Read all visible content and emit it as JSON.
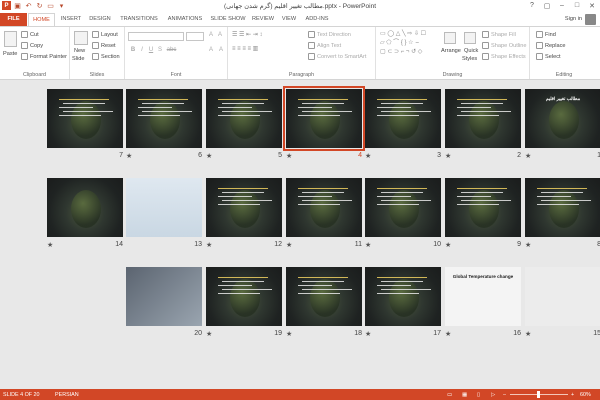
{
  "window": {
    "title": "مطالب تغییر اقلیم (گرم شدن جهانی).pptx - PowerPoint",
    "controls": [
      "?",
      "▢",
      "–",
      "□",
      "✕"
    ]
  },
  "tabs": [
    "FILE",
    "HOME",
    "INSERT",
    "DESIGN",
    "TRANSITIONS",
    "ANIMATIONS",
    "SLIDE SHOW",
    "REVIEW",
    "VIEW",
    "ADD-INS"
  ],
  "active_tab": "HOME",
  "user": {
    "signin": "Sign in"
  },
  "ribbon": {
    "clipboard": {
      "label": "Clipboard",
      "paste": "Paste",
      "cut": "Cut",
      "copy": "Copy",
      "format_painter": "Format Painter"
    },
    "slides": {
      "label": "Slides",
      "new_slide": "New",
      "new_slide2": "Slide",
      "layout": "Layout",
      "reset": "Reset",
      "section": "Section"
    },
    "font": {
      "label": "Font",
      "bold": "B",
      "italic": "I",
      "underline": "U",
      "strike": "S",
      "shadow": "abc",
      "grow": "A",
      "shrink": "A",
      "clear": "A",
      "color": "A"
    },
    "paragraph": {
      "label": "Paragraph",
      "text_direction": "Text Direction",
      "align_text": "Align Text",
      "smartart": "Convert to SmartArt"
    },
    "drawing": {
      "label": "Drawing",
      "arrange": "Arrange",
      "quick_styles": "Quick",
      "quick_styles2": "Styles",
      "shape_fill": "Shape Fill",
      "shape_outline": "Shape Outline",
      "shape_effects": "Shape Effects"
    },
    "editing": {
      "label": "Editing",
      "find": "Find",
      "replace": "Replace",
      "select": "Select"
    }
  },
  "slides": [
    {
      "num": "1",
      "star": "★",
      "title": "مطالب تغییر اقلیم"
    },
    {
      "num": "2",
      "star": "★"
    },
    {
      "num": "3",
      "star": "★"
    },
    {
      "num": "4",
      "star": "★",
      "selected": true
    },
    {
      "num": "5",
      "star": "★"
    },
    {
      "num": "6",
      "star": "★"
    },
    {
      "num": "7",
      "star": ""
    },
    {
      "num": "8",
      "star": "★"
    },
    {
      "num": "9",
      "star": "★"
    },
    {
      "num": "10",
      "star": "★"
    },
    {
      "num": "11",
      "star": "★"
    },
    {
      "num": "12",
      "star": "★"
    },
    {
      "num": "13",
      "star": ""
    },
    {
      "num": "14",
      "star": "★"
    },
    {
      "num": "15",
      "star": "★"
    },
    {
      "num": "16",
      "star": "★",
      "title": "Global Temperature change"
    },
    {
      "num": "17",
      "star": "★"
    },
    {
      "num": "18",
      "star": "★"
    },
    {
      "num": "19",
      "star": "★"
    },
    {
      "num": "20",
      "star": ""
    }
  ],
  "status": {
    "slide_count": "SLIDE 4 OF 20",
    "language": "PERSIAN",
    "zoom": "60%"
  },
  "colors": {
    "accent": "#d24726",
    "workspace": "#e8e8e8"
  }
}
